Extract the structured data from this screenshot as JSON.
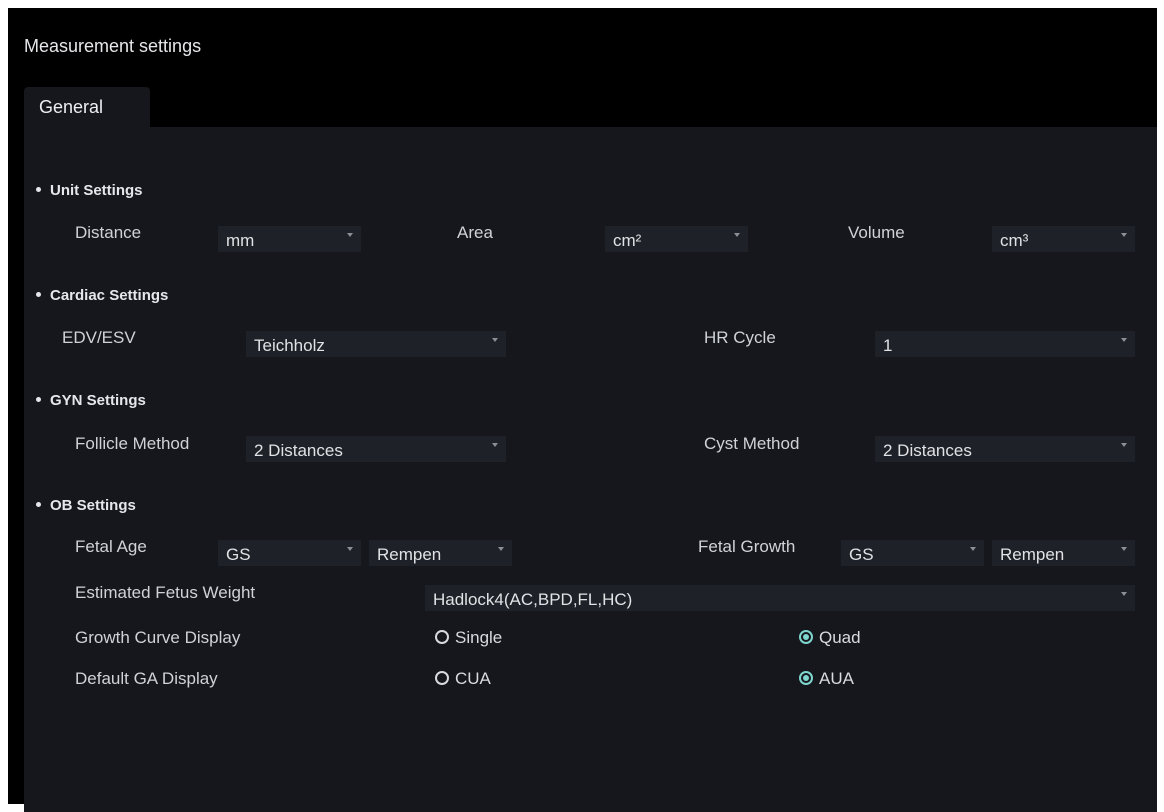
{
  "window": {
    "title": "Measurement settings"
  },
  "tabs": [
    {
      "label": "General",
      "active": true
    }
  ],
  "unit_settings": {
    "heading": "Unit Settings",
    "distance": {
      "label": "Distance",
      "value": "mm"
    },
    "area": {
      "label": "Area",
      "value": "cm²"
    },
    "volume": {
      "label": "Volume",
      "value": "cm³"
    }
  },
  "cardiac_settings": {
    "heading": "Cardiac Settings",
    "edv_esv": {
      "label": "EDV/ESV",
      "value": "Teichholz"
    },
    "hr_cycle": {
      "label": "HR Cycle",
      "value": "1"
    }
  },
  "gyn_settings": {
    "heading": "GYN Settings",
    "follicle_method": {
      "label": "Follicle Method",
      "value": "2 Distances"
    },
    "cyst_method": {
      "label": "Cyst Method",
      "value": "2 Distances"
    }
  },
  "ob_settings": {
    "heading": "OB Settings",
    "fetal_age": {
      "label": "Fetal Age",
      "value1": "GS",
      "value2": "Rempen"
    },
    "fetal_growth": {
      "label": "Fetal Growth",
      "value1": "GS",
      "value2": "Rempen"
    },
    "estimated_fetus_weight": {
      "label": "Estimated Fetus Weight",
      "value": "Hadlock4(AC,BPD,FL,HC)"
    },
    "growth_curve_display": {
      "label": "Growth Curve Display",
      "option1": "Single",
      "option2": "Quad",
      "selected": "Quad"
    },
    "default_ga_display": {
      "label": "Default GA Display",
      "option1": "CUA",
      "option2": "AUA",
      "selected": "AUA"
    }
  },
  "colors": {
    "accent": "#7fd6cf",
    "panel": "#15171c",
    "field": "#1e2127",
    "background": "#000000"
  },
  "icons": {
    "dropdown": "caret-down-icon",
    "radio_on": "radio-checked-icon",
    "radio_off": "radio-unchecked-icon"
  }
}
